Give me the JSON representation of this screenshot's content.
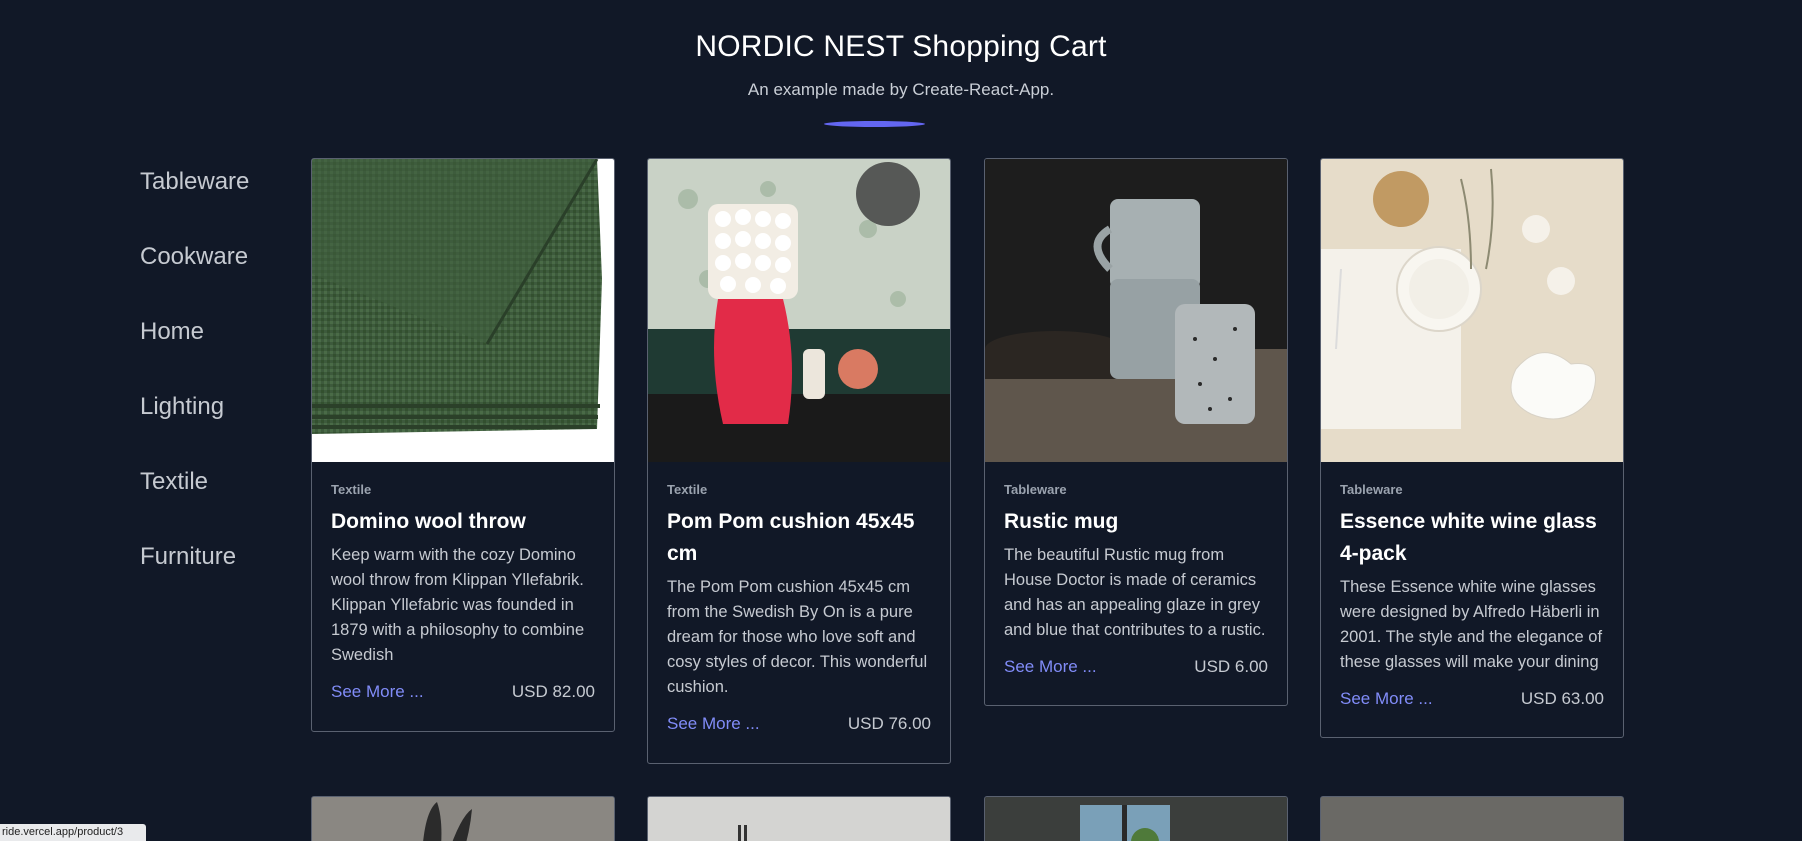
{
  "header": {
    "title": "NORDIC NEST Shopping Cart",
    "subtitle": "An example made by Create-React-App."
  },
  "colors": {
    "background": "#111827",
    "accent": "#6366f1",
    "link": "#818cf8",
    "border": "#5a6170"
  },
  "sidebar": {
    "items": [
      {
        "label": "Tableware"
      },
      {
        "label": "Cookware"
      },
      {
        "label": "Home"
      },
      {
        "label": "Lighting"
      },
      {
        "label": "Textile"
      },
      {
        "label": "Furniture"
      }
    ]
  },
  "products": [
    {
      "category": "Textile",
      "title": "Domino wool throw",
      "description": "Keep warm with the cozy Domino wool throw from Klippan Yllefabrik. Klippan Yllefabric was founded in 1879 with a philosophy to combine Swedish",
      "link": "See More ...",
      "price": "USD 82.00",
      "image": "green-wool-throw-image"
    },
    {
      "category": "Textile",
      "title": "Pom Pom cushion 45x45 cm",
      "description": "The Pom Pom cushion 45x45 cm from the Swedish By On is a pure dream for those who love soft and cosy styles of decor. This wonderful cushion.",
      "link": "See More ...",
      "price": "USD 76.00",
      "image": "pom-pom-cushion-image"
    },
    {
      "category": "Tableware",
      "title": "Rustic mug",
      "description": "The beautiful Rustic mug from House Doctor is made of ceramics and has an appealing glaze in grey and blue that contributes to a rustic.",
      "link": "See More ...",
      "price": "USD 6.00",
      "image": "rustic-mugs-image"
    },
    {
      "category": "Tableware",
      "title": "Essence white wine glass 4-pack",
      "description": "These Essence white wine glasses were designed by Alfredo Häberli in 2001. The style and the elegance of these glasses will make your dining",
      "link": "See More ...",
      "price": "USD 63.00",
      "image": "wine-glass-tableware-image"
    }
  ],
  "status_bar": {
    "url": "ride.vercel.app/product/3"
  }
}
